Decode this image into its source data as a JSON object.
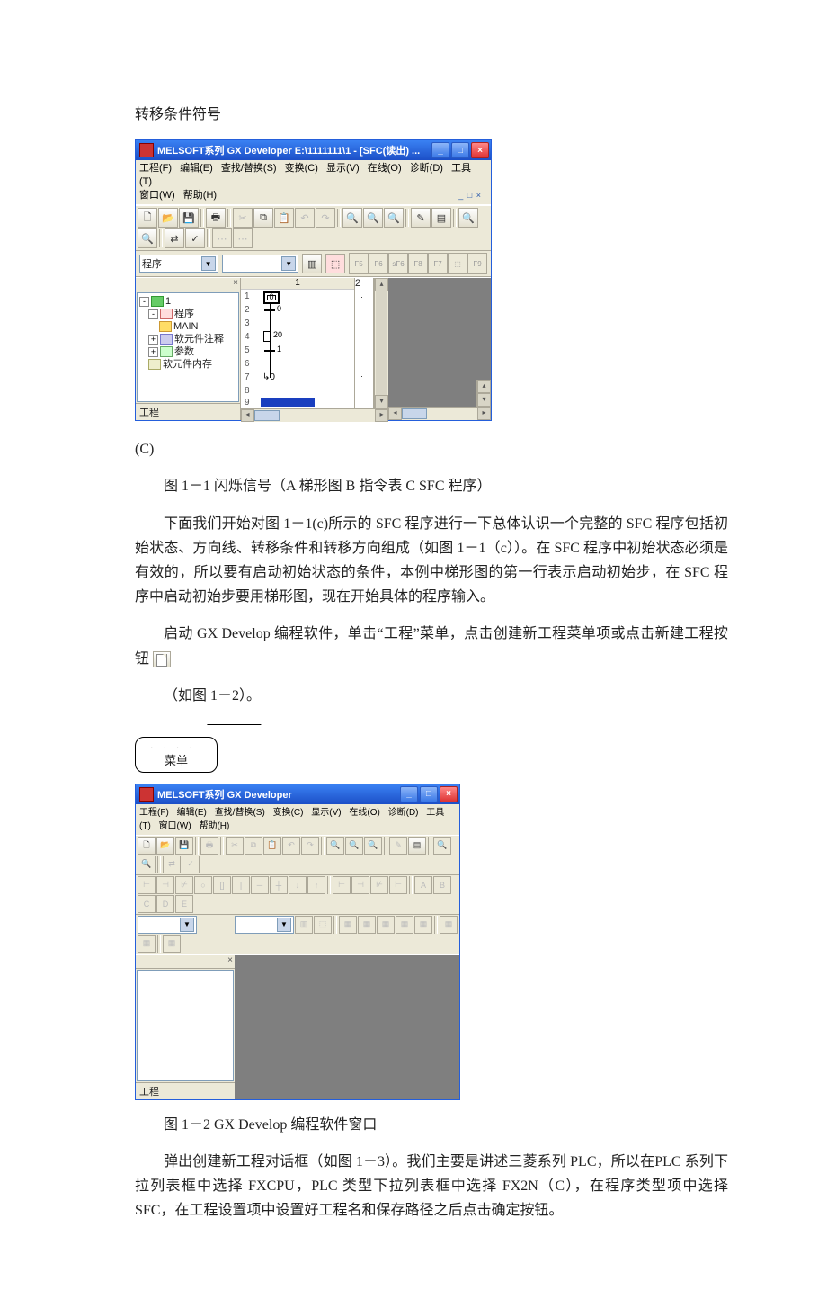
{
  "text": {
    "heading_transfer": "转移条件符号",
    "label_c": "(C)",
    "fig1_caption": "图 1－1 闪烁信号（A 梯形图 B 指令表 C SFC 程序）",
    "para1": "下面我们开始对图 1－1(c)所示的 SFC 程序进行一下总体认识一个完整的 SFC 程序包括初始状态、方向线、转移条件和转移方向组成（如图 1－1（c））。在 SFC 程序中初始状态必须是有效的，所以要有启动初始状态的条件，本例中梯形图的第一行表示启动初始步，在 SFC 程序中启动初始步要用梯形图，现在开始具体的程序输入。",
    "para2a": "启动 GX Develop 编程软件，单击“工程”菜单，点击创建新工程菜单项或点击新建工程按钮",
    "para2b": "（如图 1－2）。",
    "callout_label": "菜单",
    "fig2_caption": "图 1－2 GX Develop 编程软件窗口",
    "para3": "弹出创建新工程对话框（如图 1－3）。我们主要是讲述三菱系列 PLC，所以在PLC 系列下拉列表框中选择 FXCPU，PLC 类型下拉列表框中选择 FX2N（C），在程序类型项中选择 SFC，在工程设置项中设置好工程名和保存路径之后点击确定按钮。"
  },
  "screenshot1": {
    "title": "MELSOFT系列 GX Developer E:\\1111111\\1 - [SFC(读出)  ...",
    "menus": [
      "工程(F)",
      "编辑(E)",
      "查找/替换(S)",
      "变换(C)",
      "显示(V)",
      "在线(O)",
      "诊断(D)",
      "工具(T)",
      "窗口(W)",
      "帮助(H)"
    ],
    "tree_root": "1",
    "tree_items": [
      "程序",
      "MAIN",
      "软元件注释",
      "参数",
      "软元件内存"
    ],
    "tab_label": "工程",
    "combo_value": "程序",
    "sfc_columns": [
      "1",
      "2"
    ],
    "sfc_rows": [
      "1",
      "2",
      "3",
      "4",
      "5",
      "6",
      "7",
      "8",
      "9"
    ],
    "steps": [
      {
        "row": 1,
        "label": "0",
        "initial": true
      },
      {
        "row": 4,
        "label": "20"
      },
      {
        "row": 7,
        "label": "0",
        "jump": true
      }
    ],
    "transitions": [
      {
        "row": 2,
        "label": "0"
      },
      {
        "row": 5,
        "label": "1"
      }
    ]
  },
  "screenshot2": {
    "title": "MELSOFT系列 GX Developer",
    "menus": [
      "工程(F)",
      "编辑(E)",
      "查找/替换(S)",
      "变换(C)",
      "显示(V)",
      "在线(O)",
      "诊断(D)",
      "工具(T)",
      "窗口(W)",
      "帮助(H)"
    ],
    "tab_label": "工程"
  }
}
